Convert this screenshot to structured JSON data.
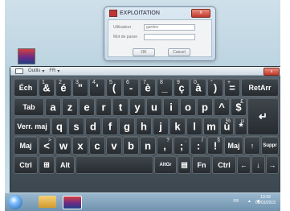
{
  "dialog": {
    "title": "EXPLOITATION",
    "close_label": "x",
    "user_label": "Utilisateur",
    "user_value": "gardev",
    "password_label": "Mot de passe",
    "ok_label": "OK",
    "cancel_label": "Cancel"
  },
  "keyboard_toolbar": {
    "tools_label": "Outils",
    "lang_label": "FR",
    "close_label": "x"
  },
  "keys": {
    "ech": "Éch",
    "k1_main": "&",
    "k1_alt": "1",
    "k2_main": "é",
    "k2_alt": "2",
    "k3_main": "\"",
    "k3_alt": "3",
    "k4_main": "'",
    "k4_alt": "4",
    "k5_main": "(",
    "k5_alt": "5",
    "k6_main": "-",
    "k6_alt": "6",
    "k7_main": "è",
    "k7_alt": "7",
    "k8_main": "_",
    "k8_alt": "8",
    "k9_main": "ç",
    "k9_alt": "9",
    "k0_main": "à",
    "k0_alt": "0",
    "kpar_main": ")",
    "kpar_alt": "°",
    "keq_main": "=",
    "keq_alt": "+",
    "retarr": "RetArr",
    "tab": "Tab",
    "a": "a",
    "z": "z",
    "e": "e",
    "r": "r",
    "t": "t",
    "y": "y",
    "u": "u",
    "i": "i",
    "o": "o",
    "p": "p",
    "caret_main": "^",
    "caret_alt": "¨",
    "dollar_main": "$",
    "dollar_alt": "£",
    "enter": "↵",
    "vermaj": "Verr. maj",
    "q": "q",
    "s": "s",
    "d": "d",
    "f": "f",
    "g": "g",
    "h": "h",
    "j": "j",
    "k": "k",
    "l": "l",
    "m": "m",
    "ugrave_main": "ù",
    "ugrave_alt": "%",
    "star_main": "*",
    "star_alt": "µ",
    "maj": "Maj",
    "lt_main": "<",
    "lt_alt": ">",
    "w": "w",
    "x": "x",
    "c": "c",
    "v": "v",
    "b": "b",
    "n": "n",
    "comma_main": ",",
    "comma_alt": "?",
    "semi_main": ";",
    "semi_alt": ".",
    "colon_main": ":",
    "colon_alt": "/",
    "excl_main": "!",
    "excl_alt": "§",
    "maj_right": "Maj",
    "up": "↑",
    "suppr": "Suppr",
    "ctrl": "Ctrl",
    "win": "⊞",
    "alt": "Alt",
    "altgr": "AltGr",
    "menu": "▤",
    "fn": "Fn",
    "ctrl_right": "Ctrl",
    "left": "←",
    "down": "↓",
    "right": "→"
  },
  "taskbar": {
    "lang": "FR",
    "time": "13:29",
    "date": "06/03/2015"
  }
}
